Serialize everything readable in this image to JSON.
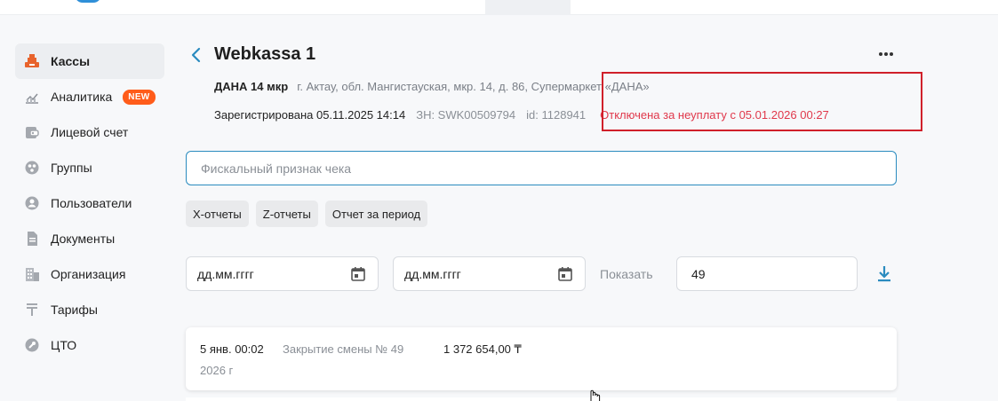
{
  "sidebar": {
    "items": [
      {
        "label": "Кассы",
        "icon": "cash-register-icon",
        "active": true
      },
      {
        "label": "Аналитика",
        "icon": "chart-icon",
        "badge": "NEW"
      },
      {
        "label": "Лицевой счет",
        "icon": "wallet-icon"
      },
      {
        "label": "Группы",
        "icon": "groups-icon"
      },
      {
        "label": "Пользователи",
        "icon": "user-icon"
      },
      {
        "label": "Документы",
        "icon": "document-icon"
      },
      {
        "label": "Организация",
        "icon": "building-icon"
      },
      {
        "label": "Тарифы",
        "icon": "tenge-icon"
      },
      {
        "label": "ЦТО",
        "icon": "wrench-icon"
      }
    ]
  },
  "header": {
    "title": "Webkassa 1",
    "store_name": "ДАНА 14 мкр",
    "address": "г. Актау, обл. Мангистауская, мкр. 14, д. 86, Супермаркет «ДАНА»",
    "registered": "Зарегистрирована 05.11.2025 14:14",
    "serial": "ЗН: SWK00509794",
    "id": "id: 1128941",
    "status": "Отключена за неуплату с 05.01.2026 00:27"
  },
  "search": {
    "placeholder": "Фискальный признак чека"
  },
  "reports": {
    "x": "Х-отчеты",
    "z": "Z-отчеты",
    "period": "Отчет за период"
  },
  "filters": {
    "date_from": "дд.мм.гггг",
    "date_to": "дд.мм.гггг",
    "show_label": "Показать",
    "count": "49"
  },
  "shifts": [
    {
      "date": "5 янв. 00:02",
      "year": "2026 г",
      "description": "Закрытие смены № 49",
      "amount": "1 372 654,00 ₸"
    }
  ],
  "colors": {
    "accent": "#2a8bbf",
    "alert": "#e0384b",
    "badge": "#ff5c1a",
    "highlight_box": "#d0202a"
  }
}
